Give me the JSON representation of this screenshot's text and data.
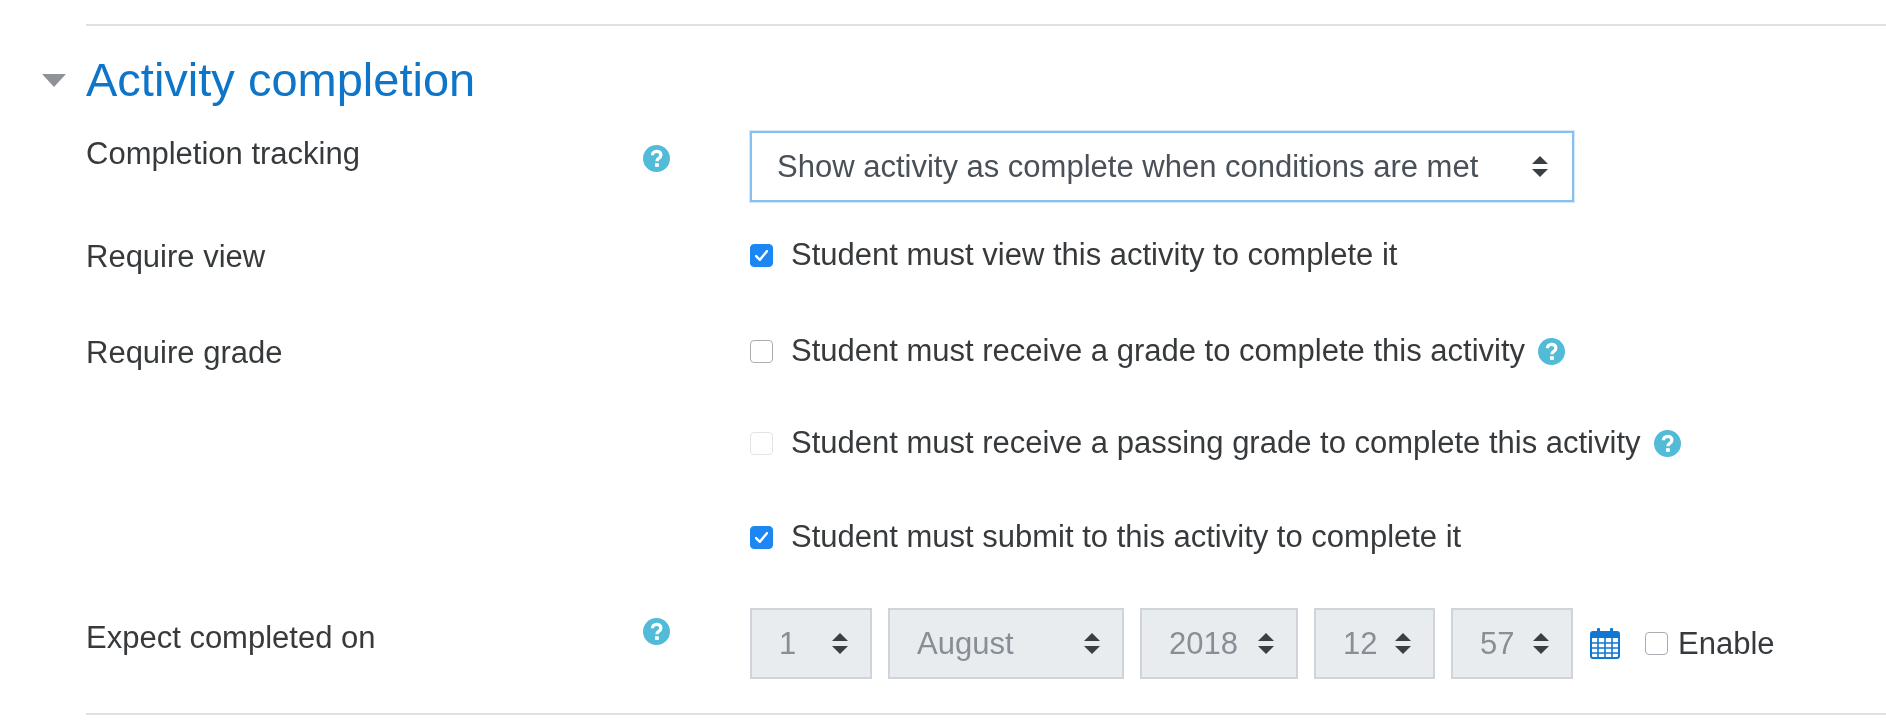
{
  "section": {
    "title": "Activity completion",
    "expanded": true
  },
  "fields": [
    {
      "kind": "select",
      "label": "Completion tracking",
      "help": true,
      "value": "Show activity as complete when conditions are met",
      "focused": true
    },
    {
      "kind": "checkboxes",
      "label": "Require view",
      "help": false,
      "options": [
        {
          "label": "Student must view this activity to complete it",
          "checked": true,
          "disabled": false,
          "help": false
        }
      ]
    },
    {
      "kind": "checkboxes",
      "label": "Require grade",
      "help": false,
      "options": [
        {
          "label": "Student must receive a grade to complete this activity",
          "checked": false,
          "disabled": false,
          "help": true
        },
        {
          "label": "Student must receive a passing grade to complete this activity",
          "checked": false,
          "disabled": true,
          "help": true
        }
      ]
    },
    {
      "kind": "checkboxes",
      "help": false,
      "options": [
        {
          "label": "Student must submit to this activity to complete it",
          "checked": true,
          "disabled": false,
          "help": false
        }
      ]
    },
    {
      "kind": "datetime",
      "label": "Expect completed on",
      "help": true,
      "disabled": true,
      "parts": [
        "1",
        "August",
        "2018",
        "12",
        "57"
      ],
      "enable": {
        "label": "Enable",
        "checked": false
      }
    }
  ]
}
